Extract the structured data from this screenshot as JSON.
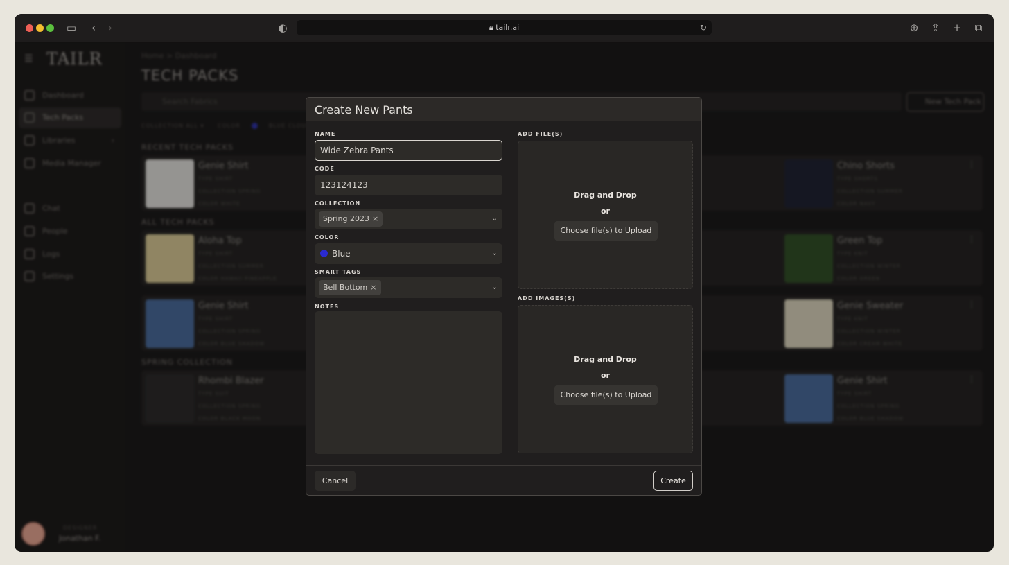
{
  "browser": {
    "url": "tailr.ai"
  },
  "sidebar": {
    "logo": "TAILR",
    "items": [
      {
        "label": "Dashboard"
      },
      {
        "label": "Tech Packs"
      },
      {
        "label": "Libraries"
      },
      {
        "label": "Media Manager"
      },
      {
        "label": "Chat"
      },
      {
        "label": "People"
      },
      {
        "label": "Logs"
      },
      {
        "label": "Settings"
      }
    ],
    "user": {
      "role": "DESIGNER",
      "name": "Jonathan F."
    }
  },
  "main": {
    "breadcrumb": "Home  >  Dashboard",
    "title": "TECH PACKS",
    "search_placeholder": "Search Fabrics",
    "new_button": "New Tech Pack",
    "filter_collection": "COLLECTION  ALL ▾",
    "filter_color": "COLOR",
    "filter_color_value": "BLUE CLOUD",
    "sections": [
      "RECENT TECH PACKS",
      "ALL TECH PACKS",
      "SPRING COLLECTION"
    ],
    "cards": [
      {
        "name": "Genie Shirt",
        "type": "SHIRT",
        "collection": "SPRING",
        "color": "WHITE"
      },
      {
        "name": "Aloha Top",
        "type": "SHIRT",
        "collection": "SUMMER",
        "color": "HAWAII PINEAPPLE"
      },
      {
        "name": "Genie Shirt",
        "type": "SHIRT",
        "collection": "SPRING",
        "color": "BLUE SHADOW"
      },
      {
        "name": "Rhombi Blazer",
        "type": "SUIT",
        "collection": "SPRING",
        "color": "BLACK MOON"
      },
      {
        "name": "Chino Shorts",
        "type": "SHORTS",
        "collection": "SUMMER",
        "color": "NAVY"
      },
      {
        "name": "Green Top",
        "type": "KNIT",
        "collection": "WINTER",
        "color": "GREEN"
      },
      {
        "name": "Genie Sweater",
        "type": "KNIT",
        "collection": "WINTER",
        "color": "CREAM WHITE"
      },
      {
        "name": "Genie Shirt",
        "type": "SHIRT",
        "collection": "SPRING",
        "color": "BLUE SHADOW"
      }
    ],
    "card_labels": {
      "type": "TYPE",
      "collection": "COLLECTION",
      "color": "COLOR"
    }
  },
  "modal": {
    "title": "Create New Pants",
    "name_label": "NAME",
    "name_value": "Wide Zebra Pants",
    "code_label": "CODE",
    "code_value": "123124123",
    "collection_label": "COLLECTION",
    "collection_chip": "Spring 2023",
    "color_label": "COLOR",
    "color_value": "Blue",
    "color_hex": "#2a2ad1",
    "tags_label": "SMART TAGS",
    "tags_chip": "Bell Bottom",
    "notes_label": "NOTES",
    "notes_value": "",
    "files_label": "ADD FILE(S)",
    "images_label": "ADD IMAGES(S)",
    "drop_text": "Drag and Drop",
    "or_text": "or",
    "upload_button": "Choose file(s) to Upload",
    "cancel_button": "Cancel",
    "create_button": "Create"
  }
}
